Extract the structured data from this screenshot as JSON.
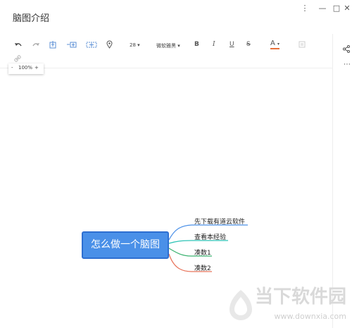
{
  "window": {
    "title": "脑图介绍",
    "controls": {
      "more": "⋮",
      "minimize": "—",
      "maximize": "□",
      "close": "✕"
    }
  },
  "toolbar": {
    "font_size": "28",
    "font_name": "微软雅黑",
    "bold": "B",
    "italic": "I",
    "underline": "U",
    "strikethrough": "S",
    "font_color": "A",
    "chevron": "▾"
  },
  "zoom": {
    "minus": "-",
    "level": "100%",
    "plus": "+"
  },
  "mindmap": {
    "root": "怎么做一个脑图",
    "children": [
      {
        "label": "先下载有道云软件",
        "color": "#4a90e8"
      },
      {
        "label": "查看本经验",
        "color": "#2ec4b6"
      },
      {
        "label": "凑数1",
        "color": "#3cb371"
      },
      {
        "label": "凑数2",
        "color": "#e8735a"
      }
    ]
  },
  "sidebar": {
    "share": "share-icon",
    "more": "⋯"
  },
  "watermark": {
    "brand": "当下软件园",
    "url": "www.downxia.com"
  }
}
